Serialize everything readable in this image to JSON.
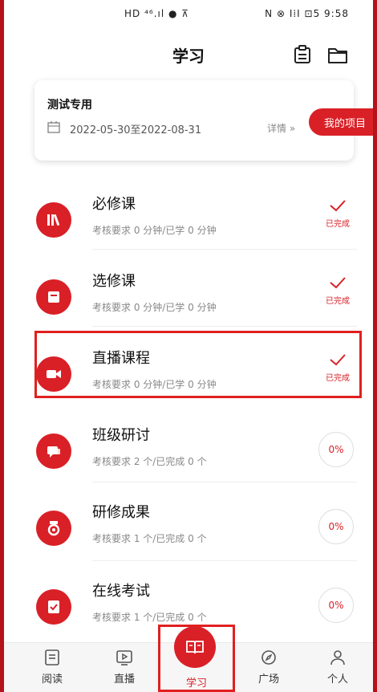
{
  "status_bar": {
    "left": "HD ⁴⁶.ıl ● ⊼",
    "right": "N ⊗ I⁞I ⊡5 9:58"
  },
  "header": {
    "title": "学习"
  },
  "project": {
    "name": "测试专用",
    "dates": "2022-05-30至2022-08-31",
    "detail": "详情 »",
    "my_projects": "我的项目"
  },
  "courses": [
    {
      "title": "必修课",
      "sub": "考核要求 0 分钟/已学 0 分钟",
      "state": "done",
      "done_label": "已完成"
    },
    {
      "title": "选修课",
      "sub": "考核要求 0 分钟/已学 0 分钟",
      "state": "done",
      "done_label": "已完成"
    },
    {
      "title": "直播课程",
      "sub": "考核要求 0 分钟/已学 0 分钟",
      "state": "done",
      "done_label": "已完成"
    },
    {
      "title": "班级研讨",
      "sub": "考核要求 2 个/已完成 0 个",
      "state": "percent",
      "percent": "0%"
    },
    {
      "title": "研修成果",
      "sub": "考核要求 1 个/已完成 0 个",
      "state": "percent",
      "percent": "0%"
    },
    {
      "title": "在线考试",
      "sub": "考核要求 1 个/已完成 0 个",
      "state": "percent",
      "percent": "0%"
    }
  ],
  "tabs": {
    "read": "阅读",
    "live": "直播",
    "learn": "学习",
    "square": "广场",
    "me": "个人"
  },
  "colors": {
    "accent": "#d92027"
  }
}
